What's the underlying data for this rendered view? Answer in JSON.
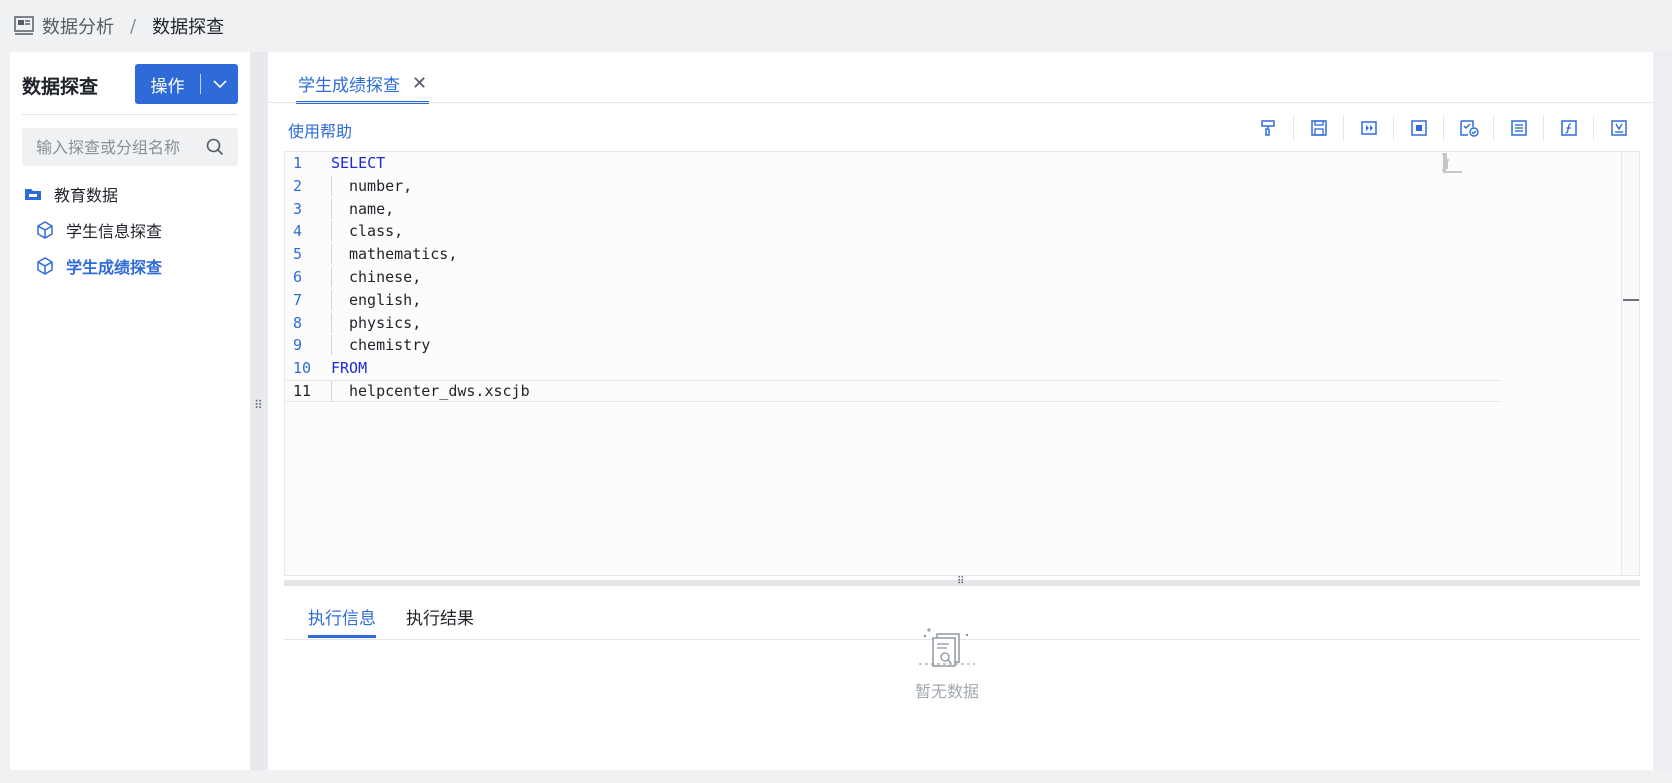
{
  "breadcrumb": {
    "root": "数据分析",
    "separator": "/",
    "current": "数据探查"
  },
  "sidebar": {
    "title": "数据探查",
    "operation_button": "操作",
    "search_placeholder": "输入探查或分组名称",
    "group": {
      "label": "教育数据",
      "icon": "folder-icon"
    },
    "items": [
      {
        "label": "学生信息探查",
        "icon": "cube-icon",
        "active": false
      },
      {
        "label": "学生成绩探查",
        "icon": "cube-icon",
        "active": true
      }
    ]
  },
  "editor_tab": {
    "label": "学生成绩探查",
    "close": "✕"
  },
  "help_link": "使用帮助",
  "toolbar_icons": [
    "format-brush-icon",
    "save-icon",
    "run-icon",
    "stop-icon",
    "check-syntax-icon",
    "outline-icon",
    "function-icon",
    "export-icon"
  ],
  "code_lines": [
    {
      "n": "1",
      "text": "SELECT",
      "kw": true
    },
    {
      "n": "2",
      "text": "number,",
      "kw": false
    },
    {
      "n": "3",
      "text": "name,",
      "kw": false
    },
    {
      "n": "4",
      "text": "class,",
      "kw": false
    },
    {
      "n": "5",
      "text": "mathematics,",
      "kw": false
    },
    {
      "n": "6",
      "text": "chinese,",
      "kw": false
    },
    {
      "n": "7",
      "text": "english,",
      "kw": false
    },
    {
      "n": "8",
      "text": "physics,",
      "kw": false
    },
    {
      "n": "9",
      "text": "chemistry",
      "kw": false
    },
    {
      "n": "10",
      "text": "FROM",
      "kw": true
    },
    {
      "n": "11",
      "text": "helpcenter_dws.xscjb",
      "kw": false
    }
  ],
  "result_tabs": [
    {
      "label": "执行信息",
      "active": true
    },
    {
      "label": "执行结果",
      "active": false
    }
  ],
  "empty_text": "暂无数据",
  "colors": {
    "primary": "#2e6bd9",
    "keyword": "#1a2ad4"
  }
}
